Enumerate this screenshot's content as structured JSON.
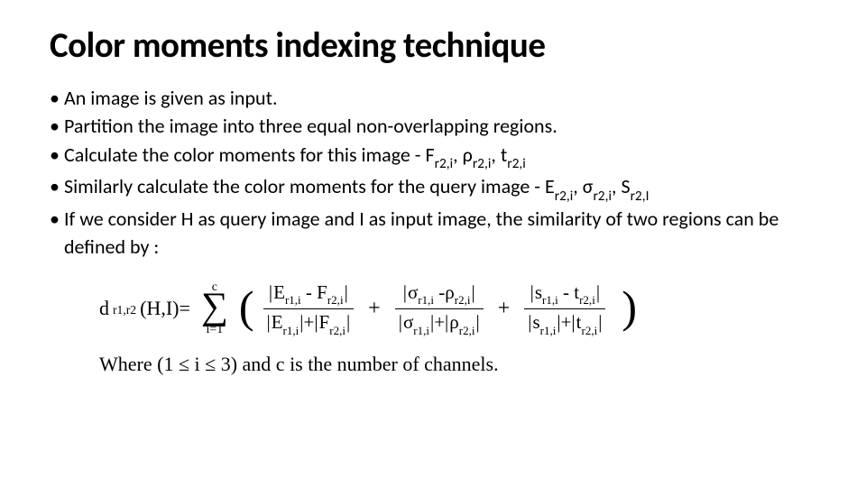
{
  "title": "Color moments indexing technique",
  "bullets": {
    "b1": "An image is given as input.",
    "b2": "Partition the image into three equal non-overlapping regions.",
    "b3a": "Calculate the color moments for this image - F",
    "b3sub1": "r2,i",
    "b3b": ",  ρ",
    "b3sub2": "r2,i",
    "b3c": ", t",
    "b3sub3": "r2,i",
    "b4a": "Similarly calculate the color moments for the query image - E",
    "b4sub1": "r2,i",
    "b4b": ", σ",
    "b4sub2": "r2,i",
    "b4c": ", S",
    "b4sub3": "r2,I",
    "b5": "If we consider H as query image and I as input image, the similarity of two regions can be defined by :"
  },
  "formula": {
    "lhs_d": "d",
    "lhs_sub": "r1,r2",
    "lhs_arg": "(H,I)=",
    "sum_top": "c",
    "sum_bot": "i=1",
    "t1n_a": "E",
    "t1n_asub": "r1,i",
    "t1n_b": "F",
    "t1n_bsub": "r2,i",
    "t1d_a": "E",
    "t1d_asub": "r1,i",
    "t1d_b": "F",
    "t1d_bsub": "r2,i",
    "t2n_a": "σ",
    "t2n_asub": "r1,i",
    "t2n_b": "ρ",
    "t2n_bsub": "r2,i",
    "t2d_a": "σ",
    "t2d_asub": "r1,i",
    "t2d_b": "ρ",
    "t2d_bsub": "r2,i",
    "t3n_a": "s",
    "t3n_asub": "r1,i",
    "t3n_b": "t",
    "t3n_bsub": "r2,i",
    "t3d_a": "s",
    "t3d_asub": "r1,i",
    "t3d_b": "t",
    "t3d_bsub": "r2,i"
  },
  "where": {
    "pre": "Where  (1 ≤ i ≤ 3)  and c is the number of channels."
  }
}
